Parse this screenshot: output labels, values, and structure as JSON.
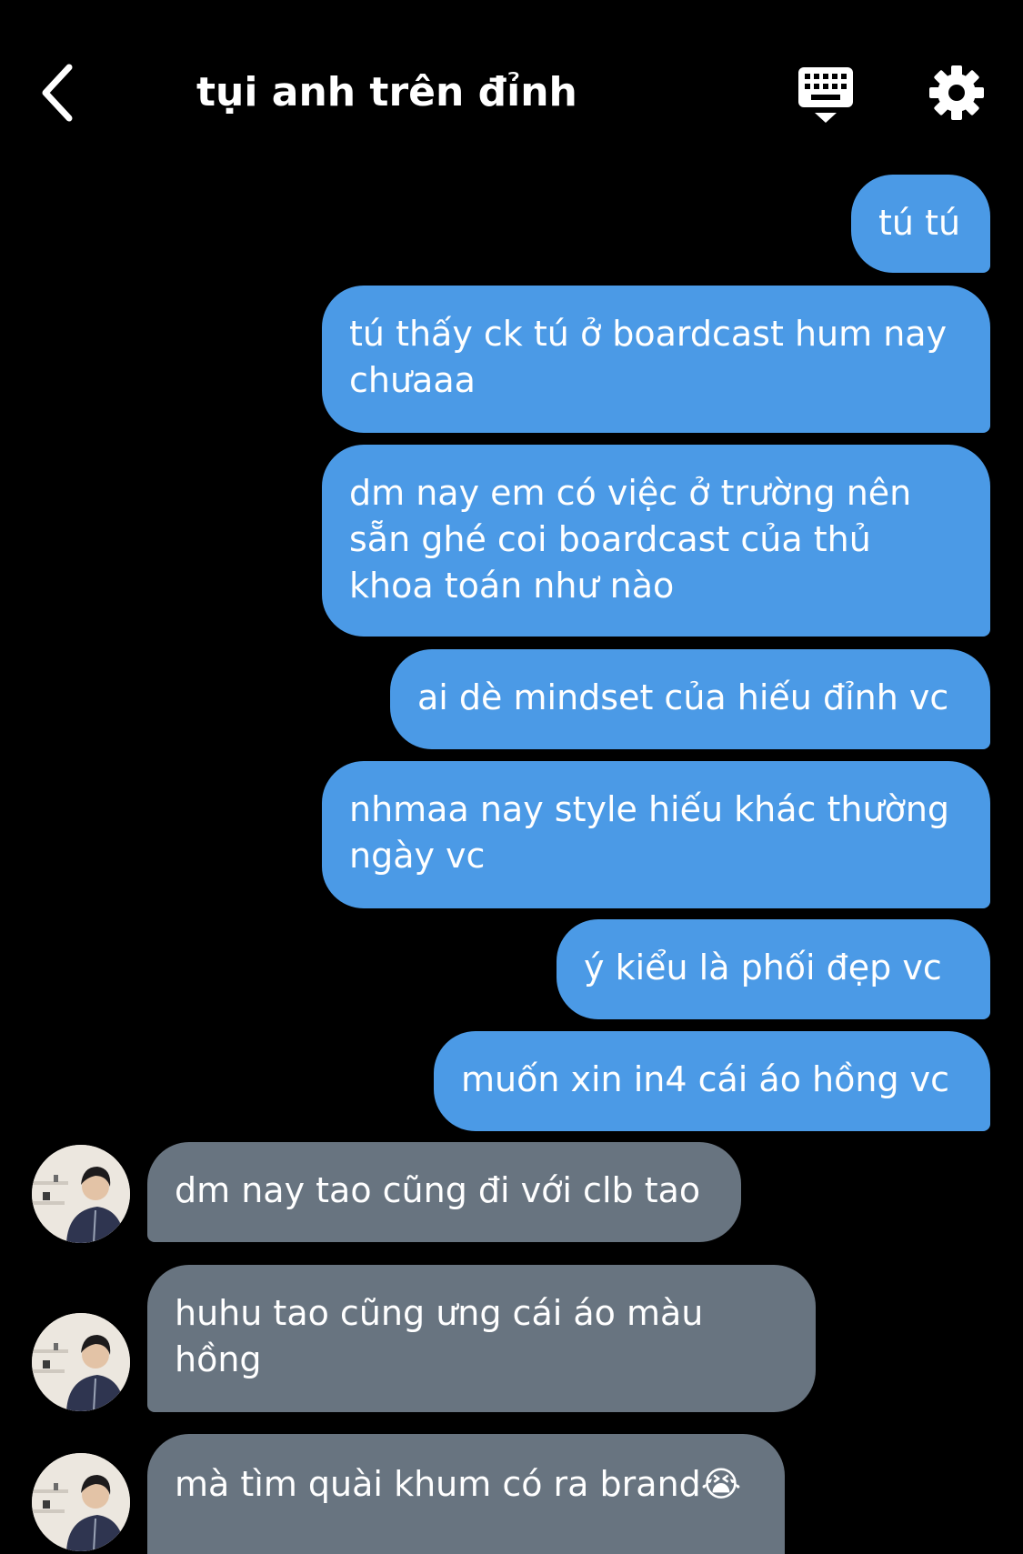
{
  "header": {
    "title": "tụi anh trên đỉnh",
    "back_icon": "chevron-left-icon",
    "keyboard_icon": "keyboard-icon",
    "settings_icon": "gear-icon"
  },
  "colors": {
    "background": "#000000",
    "outgoing_bubble": "#4b9ae6",
    "incoming_bubble": "#687480",
    "text": "#ffffff"
  },
  "messages": [
    {
      "direction": "outgoing",
      "lines": [
        "tú tú"
      ]
    },
    {
      "direction": "outgoing",
      "lines": [
        "tú thấy ck tú ở boardcast hum nay",
        "chưaaa"
      ]
    },
    {
      "direction": "outgoing",
      "lines": [
        "dm nay em có việc ở trường nên",
        "sẵn ghé coi boardcast của thủ",
        "khoa toán như nào"
      ]
    },
    {
      "direction": "outgoing",
      "lines": [
        "ai dè mindset của hiếu đỉnh vc"
      ]
    },
    {
      "direction": "outgoing",
      "lines": [
        "nhmaa nay style hiếu khác thường",
        "ngày vc"
      ]
    },
    {
      "direction": "outgoing",
      "lines": [
        "ý kiểu là phối đẹp vc"
      ]
    },
    {
      "direction": "outgoing",
      "lines": [
        "muốn xin in4 cái áo hồng vc"
      ]
    },
    {
      "direction": "incoming",
      "lines": [
        "dm nay tao cũng đi với clb tao"
      ]
    },
    {
      "direction": "incoming",
      "lines": [
        "huhu tao cũng ưng cái áo màu",
        "hồng"
      ]
    },
    {
      "direction": "incoming",
      "lines": [
        "mà tìm quài khum có ra brand😭"
      ]
    }
  ]
}
